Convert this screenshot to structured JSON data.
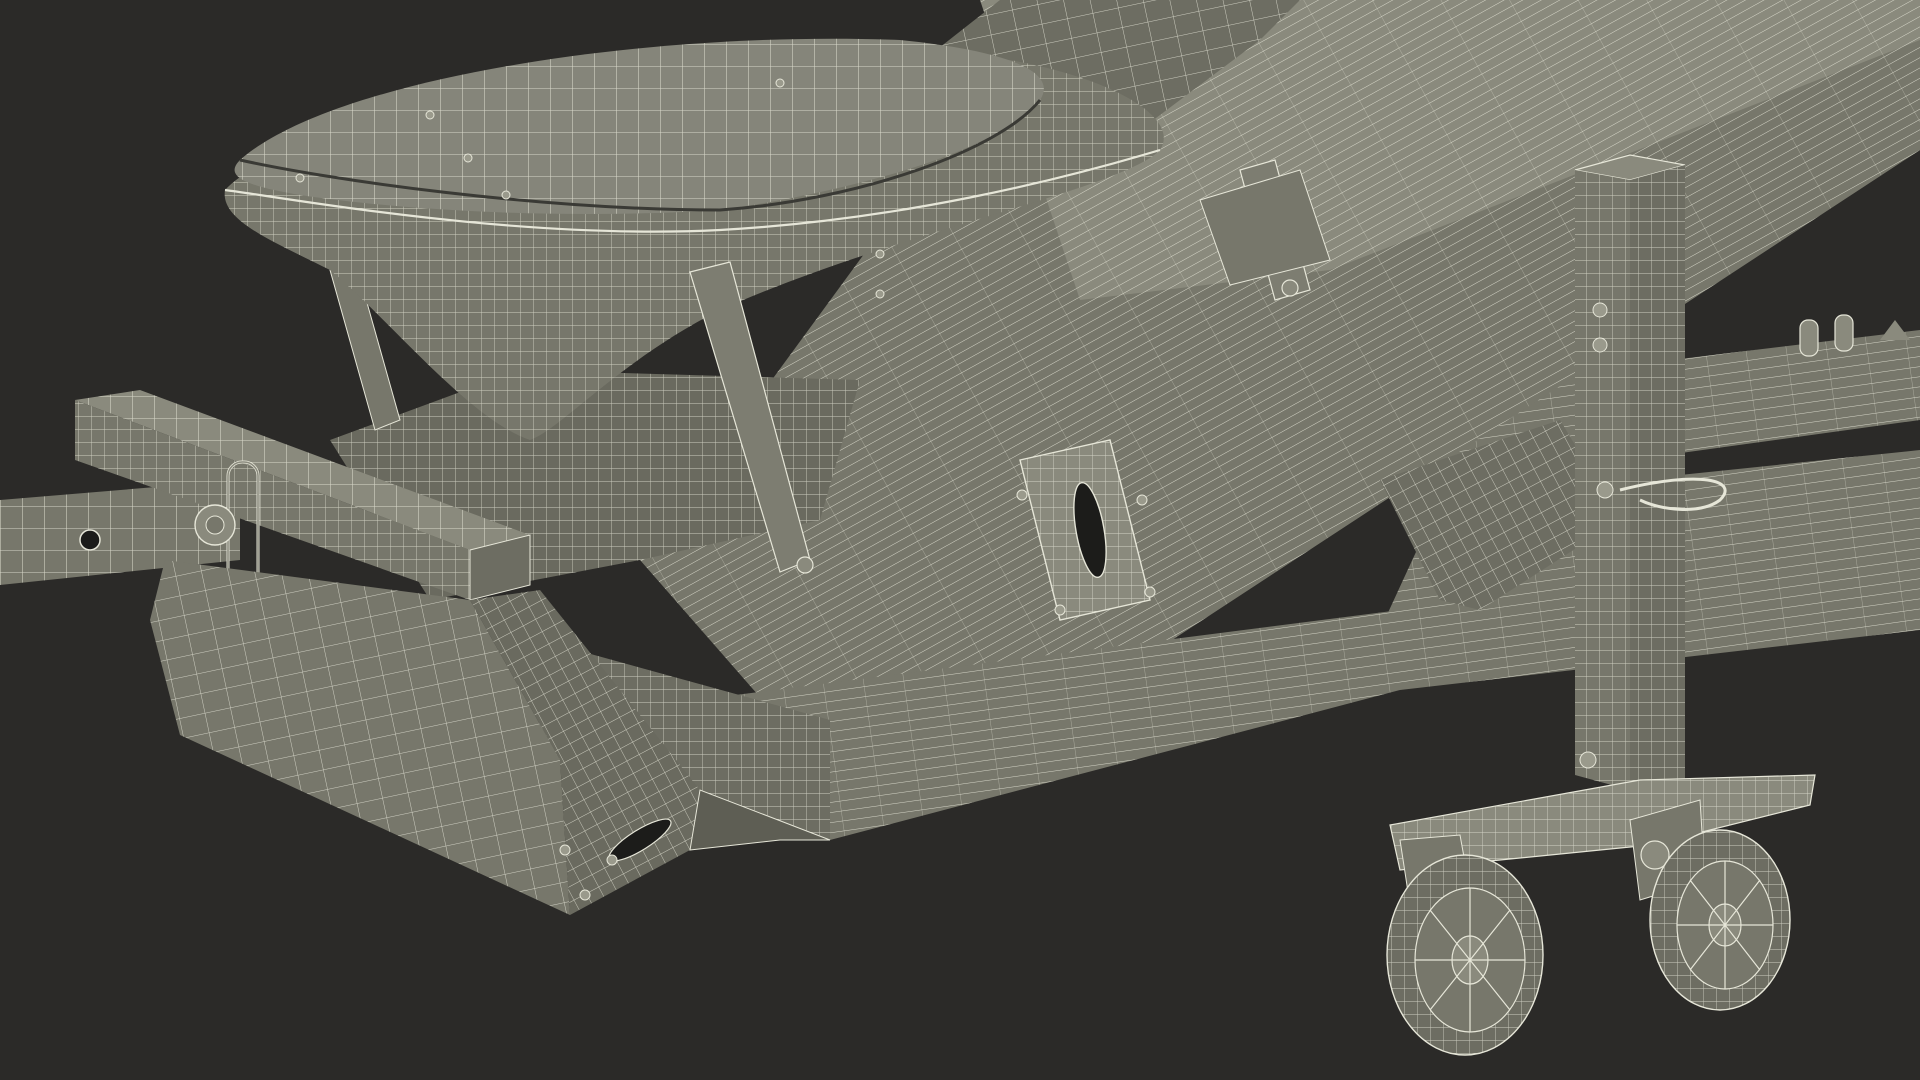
{
  "scene": {
    "subject": "wireframe-3d-model-render",
    "colors": {
      "background": "#2b2a28",
      "surface": "#77776b",
      "surface_light": "#8a8a7d",
      "surface_dark": "#5e5e54",
      "shadow": "#3a3a35",
      "wire": "#e6e6d8",
      "wire_soft": "#c9c9b9"
    },
    "parts": [
      "tow-bar",
      "hitch-pin",
      "front-crossbeam",
      "hopper-bowl",
      "hopper-chute",
      "conveyor-beam",
      "frame-rails",
      "inspection-window",
      "jack-stand",
      "caster-wheels"
    ]
  }
}
